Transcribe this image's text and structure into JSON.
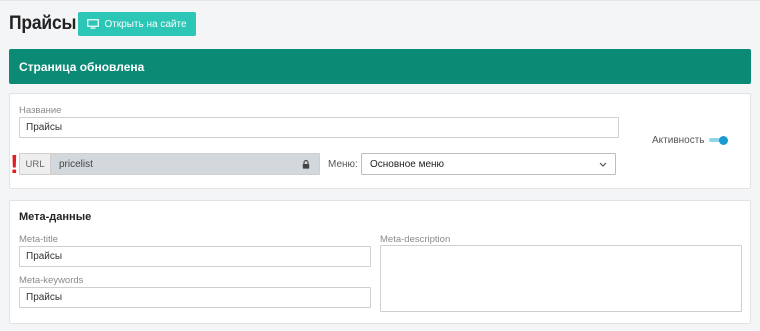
{
  "header": {
    "title": "Прайсы",
    "open_site_label": "Открыть на сайте",
    "open_site_icon": "monitor-icon"
  },
  "alert": {
    "message": "Страница обновлена",
    "color": "#0b8a76"
  },
  "main_form": {
    "name_label": "Название",
    "name_value": "Прайсы",
    "url_prefix": "URL",
    "url_value": "pricelist",
    "url_warning": "!",
    "url_lock_icon": "lock-icon",
    "menu_label": "Меню:",
    "menu_selected": "Основное меню",
    "activity_label": "Активность",
    "activity_on": true
  },
  "meta": {
    "section_title": "Мета-данные",
    "meta_title_label": "Meta-title",
    "meta_title_value": "Прайсы",
    "meta_keywords_label": "Meta-keywords",
    "meta_keywords_value": "Прайсы",
    "meta_description_label": "Meta-description",
    "meta_description_value": ""
  },
  "colors": {
    "accent_button": "#2bc6b5",
    "alert_bg": "#0b8a76",
    "toggle_on": "#1a9ad2",
    "warning": "#e02020"
  }
}
